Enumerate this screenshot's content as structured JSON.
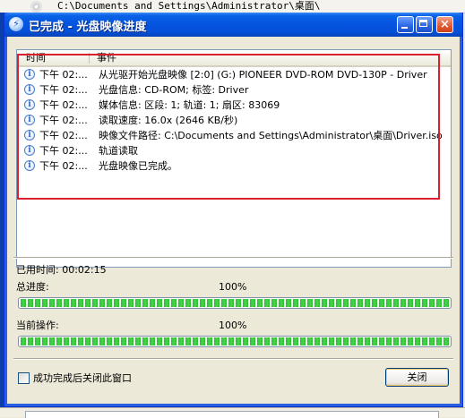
{
  "background": {
    "path_text": "C:\\Documents and Settings\\Administrator\\桌面\\"
  },
  "window": {
    "title": "已完成 - 光盘映像进度",
    "title_icon_glyph": "⚡",
    "buttons": {
      "minimize": "minimize",
      "maximize": "maximize",
      "close": "×"
    }
  },
  "log": {
    "columns": {
      "time": "时间",
      "event": "事件"
    },
    "rows": [
      {
        "time": "下午 02:...",
        "event": "从光驱开始光盘映像 [2:0] (G:) PIONEER DVD-ROM DVD-130P -   Driver"
      },
      {
        "time": "下午 02:...",
        "event": "光盘信息: CD-ROM; 标签:  Driver"
      },
      {
        "time": "下午 02:...",
        "event": "媒体信息: 区段: 1; 轨道: 1; 扇区: 83069"
      },
      {
        "time": "下午 02:...",
        "event": "读取速度: 16.0x (2646 KB/秒)"
      },
      {
        "time": "下午 02:...",
        "event": "映像文件路径: C:\\Documents and Settings\\Administrator\\桌面\\Driver.iso"
      },
      {
        "time": "下午 02:...",
        "event": "轨道读取"
      },
      {
        "time": "下午 02:...",
        "event": "光盘映像已完成。"
      }
    ]
  },
  "status": {
    "elapsed_label": "已用时间:",
    "elapsed_value": "00:02:15",
    "total_label": "总进度:",
    "total_percent": "100%",
    "total_fraction": 1.0,
    "current_label": "当前操作:",
    "current_percent": "100%",
    "current_fraction": 1.0
  },
  "footer": {
    "close_on_success_label": "成功完成后关闭此窗口",
    "close_on_success_checked": false,
    "close_button": "关闭"
  },
  "colors": {
    "title_blue": "#0554e0",
    "progress_green": "#29c22d",
    "highlight_red": "#d9202c"
  }
}
